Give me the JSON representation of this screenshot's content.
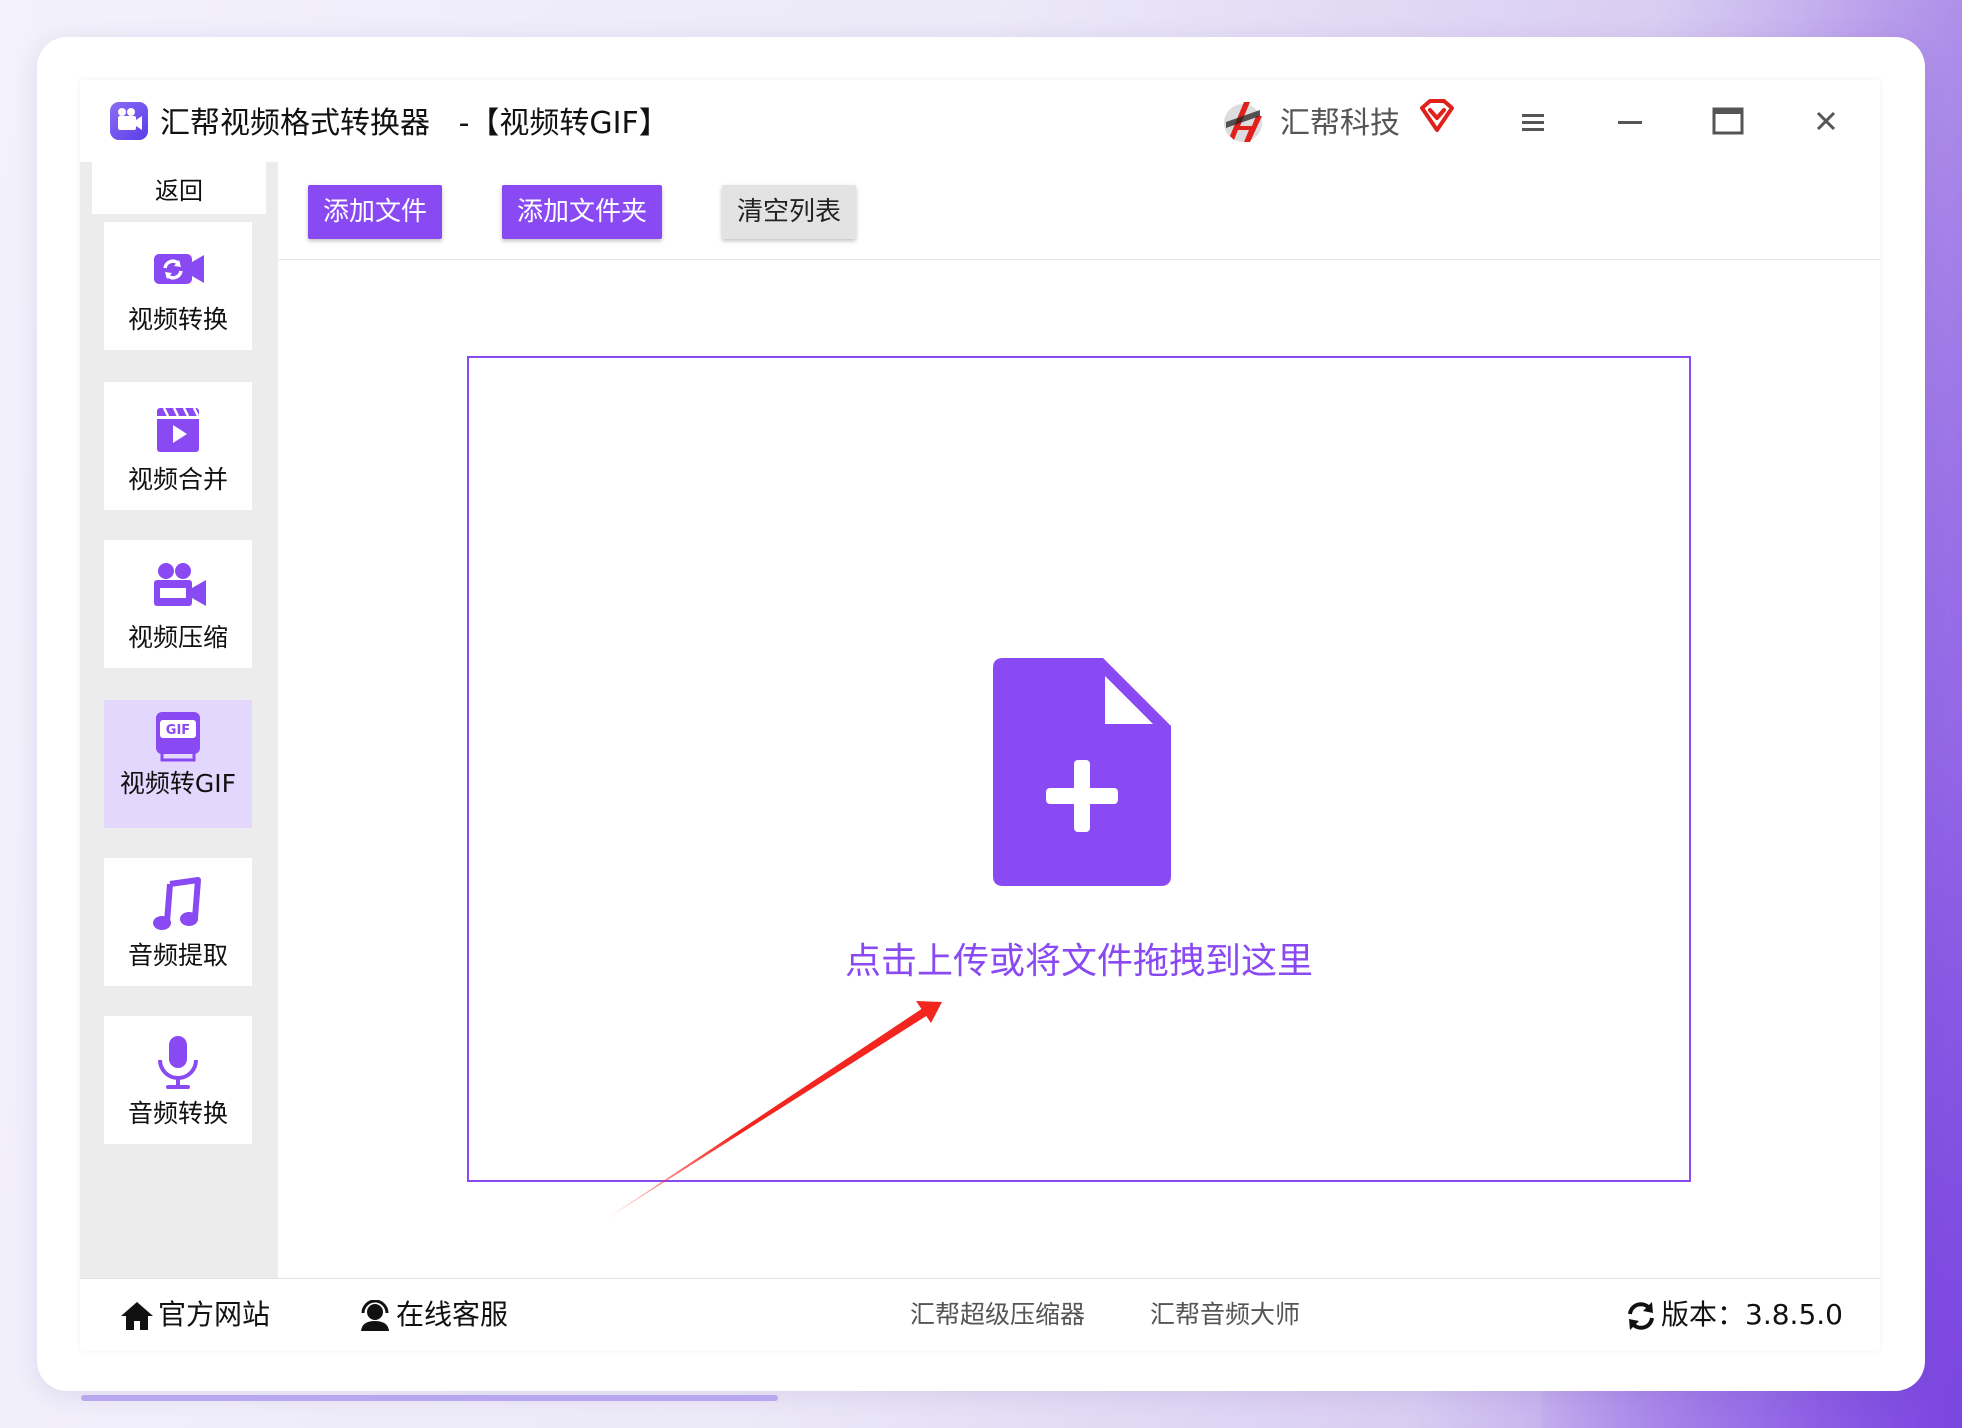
{
  "window": {
    "title": "汇帮视频格式转换器   -【视频转GIF】",
    "brand": "汇帮科技"
  },
  "sidebar": {
    "back_label": "返回",
    "items": [
      {
        "label": "视频转换",
        "icon": "video-convert-icon"
      },
      {
        "label": "视频合并",
        "icon": "video-merge-icon"
      },
      {
        "label": "视频压缩",
        "icon": "video-compress-icon"
      },
      {
        "label": "视频转GIF",
        "icon": "gif-icon",
        "active": true
      },
      {
        "label": "音频提取",
        "icon": "music-note-icon"
      },
      {
        "label": "音频转换",
        "icon": "microphone-icon"
      }
    ]
  },
  "toolbar": {
    "add_file": "添加文件",
    "add_folder": "添加文件夹",
    "clear_list": "清空列表"
  },
  "dropzone": {
    "text": "点击上传或将文件拖拽到这里"
  },
  "footer": {
    "official_site": "官方网站",
    "online_service": "在线客服",
    "compressor": "汇帮超级压缩器",
    "audio_master": "汇帮音频大师",
    "version_label": "版本：",
    "version": "3.8.5.0"
  },
  "colors": {
    "accent": "#8a4af3",
    "active_bg": "#e4d7fd",
    "arrow": "#f2261f"
  }
}
